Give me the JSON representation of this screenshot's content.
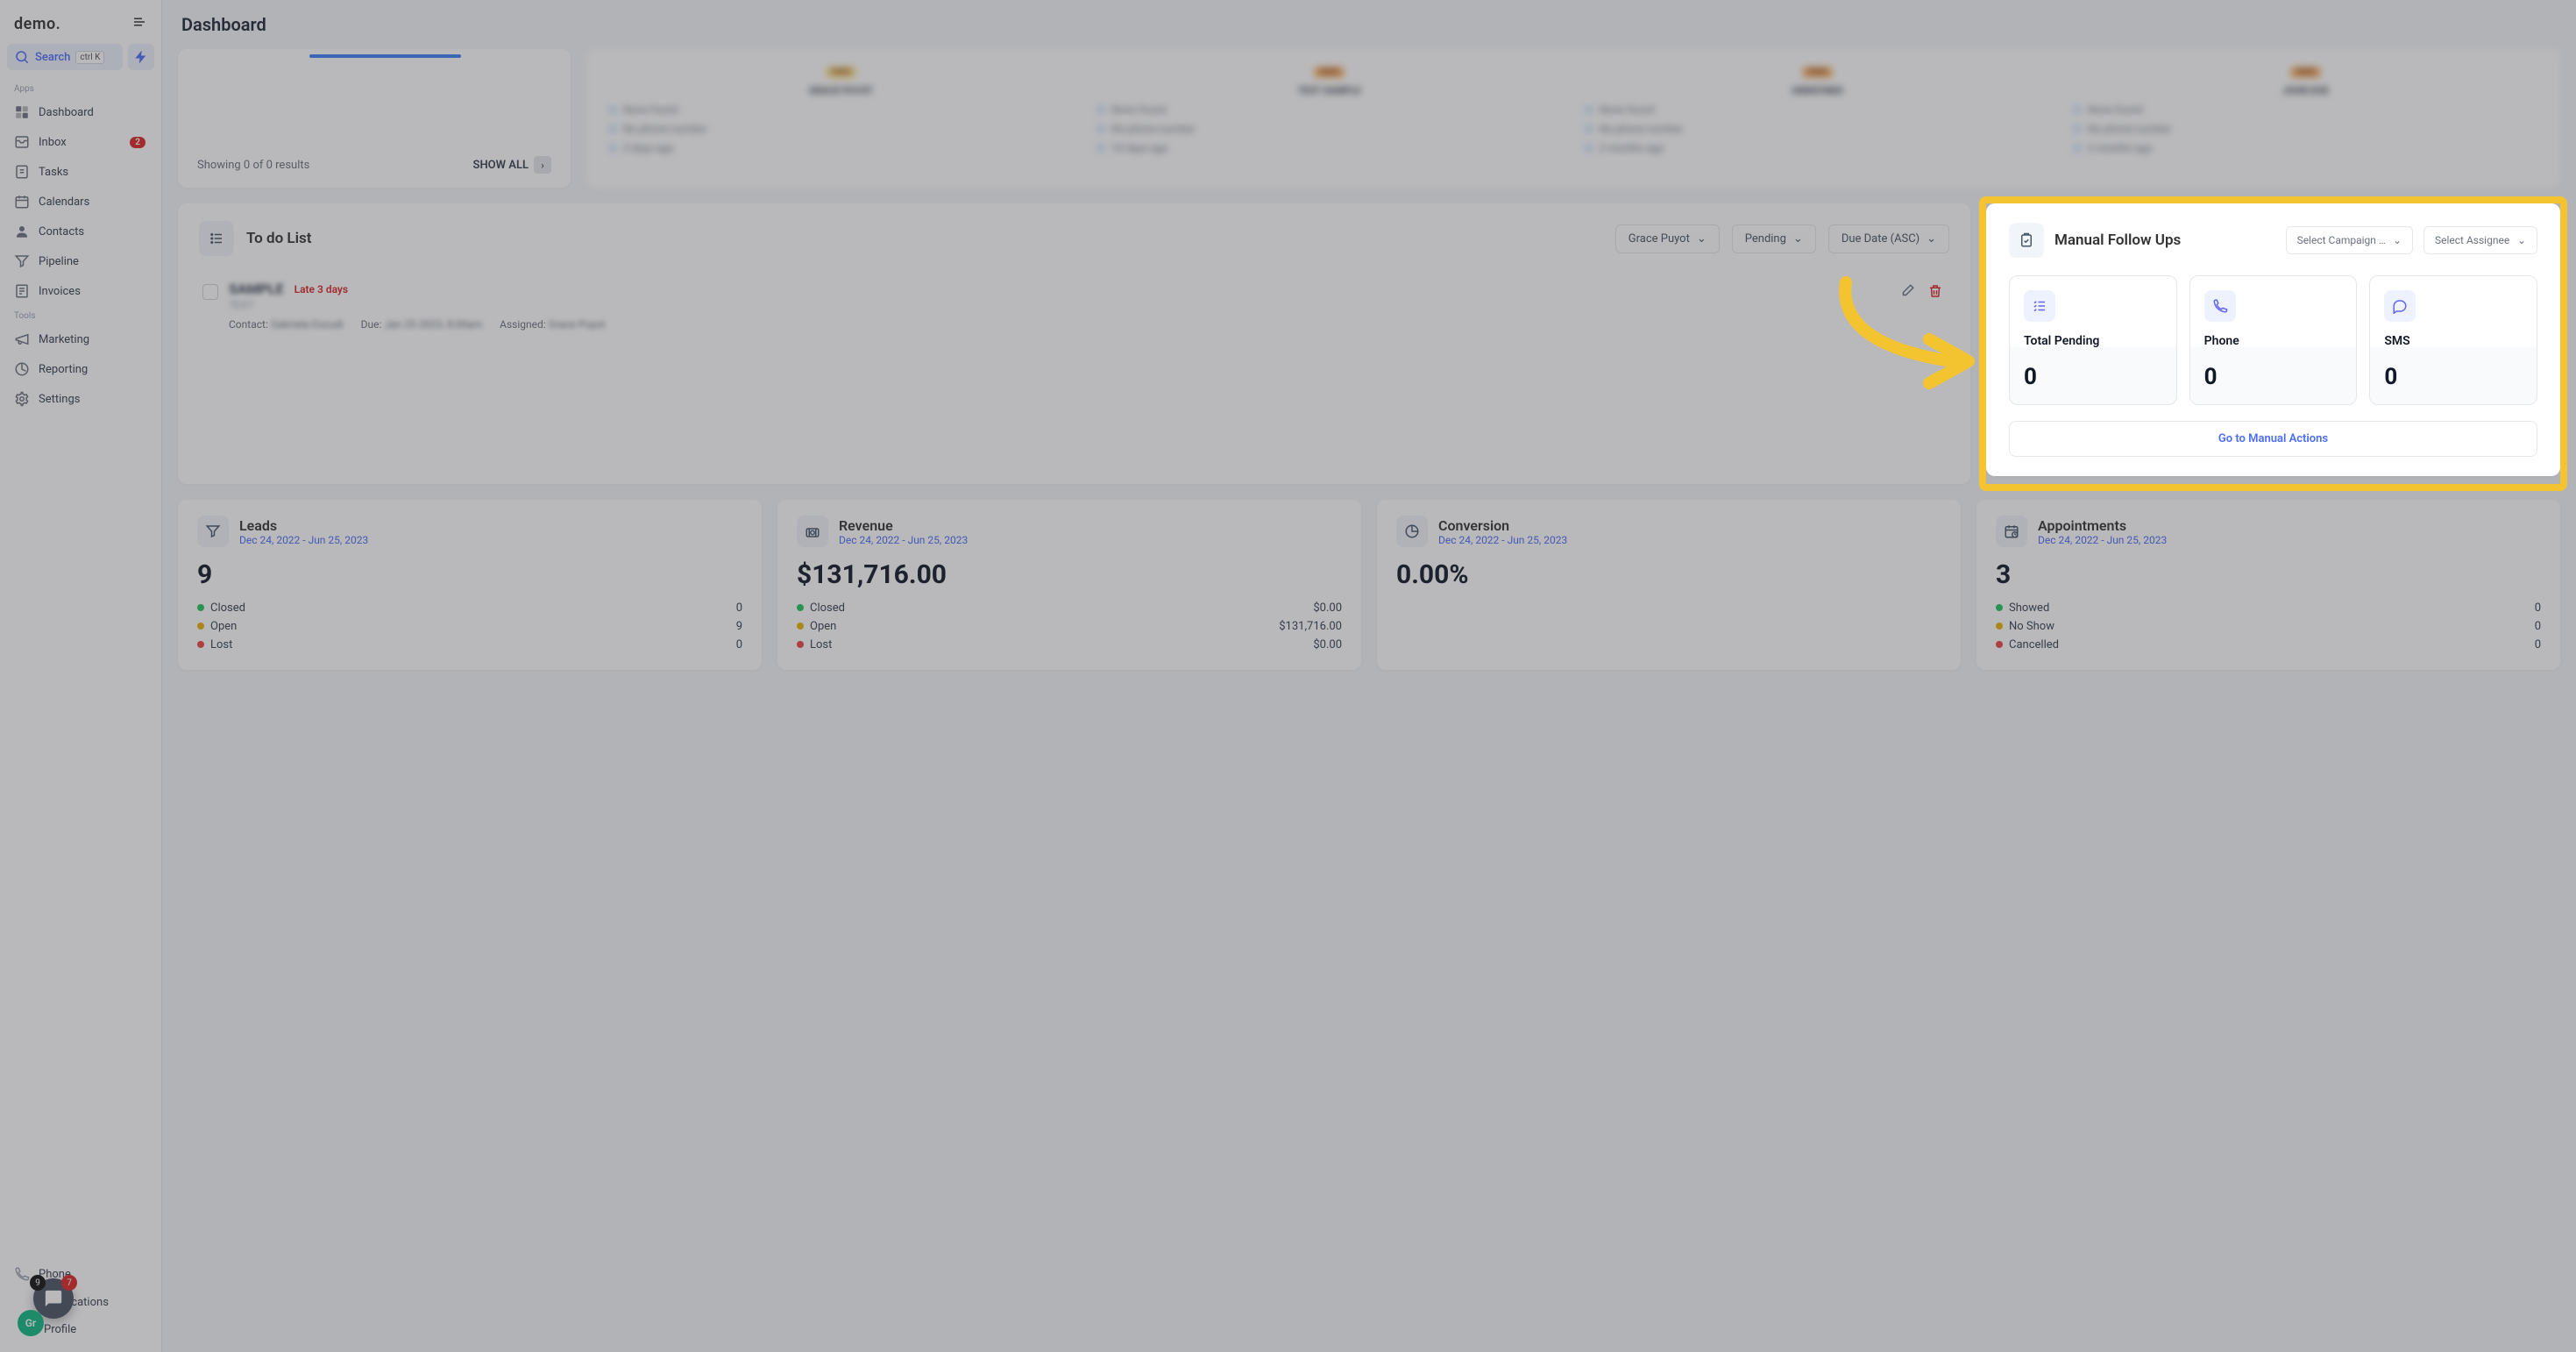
{
  "brand": "demo.",
  "page_title": "Dashboard",
  "search": {
    "label": "Search",
    "kbd": "ctrl K"
  },
  "sidebar": {
    "sections": {
      "apps": "Apps",
      "tools": "Tools"
    },
    "items": [
      {
        "label": "Dashboard"
      },
      {
        "label": "Inbox",
        "badge": "2"
      },
      {
        "label": "Tasks"
      },
      {
        "label": "Calendars"
      },
      {
        "label": "Contacts"
      },
      {
        "label": "Pipeline"
      },
      {
        "label": "Invoices"
      }
    ],
    "tools": [
      {
        "label": "Marketing"
      },
      {
        "label": "Reporting"
      },
      {
        "label": "Settings"
      }
    ],
    "bottom": [
      {
        "label": "Phone"
      },
      {
        "label": "Notifications"
      },
      {
        "label": "Profile"
      }
    ]
  },
  "chat": {
    "count_a": "9",
    "count_b": "7"
  },
  "avatar": "Gr",
  "top_left": {
    "results_text": "Showing 0 of 0 results",
    "show_all": "SHOW ALL"
  },
  "contact_cards": [
    {
      "tag": "OMG",
      "name": "GRACE PUYOT",
      "l1": "None found",
      "l2": "No phone number",
      "l3": "3 days ago"
    },
    {
      "tag": "OMG",
      "name": "TEST SAMPLE",
      "l1": "None found",
      "l2": "No phone number",
      "l3": "10 days ago"
    },
    {
      "tag": "OMG",
      "name": "UNDEFINED",
      "l1": "None found",
      "l2": "No phone number",
      "l3": "2 months ago"
    },
    {
      "tag": "OMG",
      "name": "JOHN DOE",
      "l1": "None found",
      "l2": "No phone number",
      "l3": "2 months ago"
    }
  ],
  "todo": {
    "title": "To do List",
    "filter_user": "Grace Puyot",
    "filter_status": "Pending",
    "filter_sort": "Due Date (ASC)",
    "item": {
      "name": "SAMPLE",
      "sub": "TEXT",
      "late": "Late 3 days",
      "contact_label": "Contact:",
      "contact_value": "Gabriela Escudi",
      "due_label": "Due:",
      "due_value": "Jan 25 2023, 8:00am",
      "assigned_label": "Assigned:",
      "assigned_value": "Grace Puyot"
    }
  },
  "followups": {
    "title": "Manual Follow Ups",
    "select_campaign": "Select Campaign …",
    "select_assignee": "Select Assignee",
    "stats": [
      {
        "label": "Total Pending",
        "value": "0"
      },
      {
        "label": "Phone",
        "value": "0"
      },
      {
        "label": "SMS",
        "value": "0"
      }
    ],
    "cta": "Go to Manual Actions"
  },
  "bottom_cards": [
    {
      "title": "Leads",
      "date": "Dec 24, 2022 - Jun 25, 2023",
      "value": "9",
      "rows": [
        {
          "color": "g",
          "label": "Closed",
          "val": "0"
        },
        {
          "color": "y",
          "label": "Open",
          "val": "9"
        },
        {
          "color": "r",
          "label": "Lost",
          "val": "0"
        }
      ]
    },
    {
      "title": "Revenue",
      "date": "Dec 24, 2022 - Jun 25, 2023",
      "value": "$131,716.00",
      "rows": [
        {
          "color": "g",
          "label": "Closed",
          "val": "$0.00"
        },
        {
          "color": "y",
          "label": "Open",
          "val": "$131,716.00"
        },
        {
          "color": "r",
          "label": "Lost",
          "val": "$0.00"
        }
      ]
    },
    {
      "title": "Conversion",
      "date": "Dec 24, 2022 - Jun 25, 2023",
      "value": "0.00%",
      "rows": []
    },
    {
      "title": "Appointments",
      "date": "Dec 24, 2022 - Jun 25, 2023",
      "value": "3",
      "rows": [
        {
          "color": "g",
          "label": "Showed",
          "val": "0"
        },
        {
          "color": "y",
          "label": "No Show",
          "val": "0"
        },
        {
          "color": "r",
          "label": "Cancelled",
          "val": "0"
        }
      ]
    }
  ]
}
